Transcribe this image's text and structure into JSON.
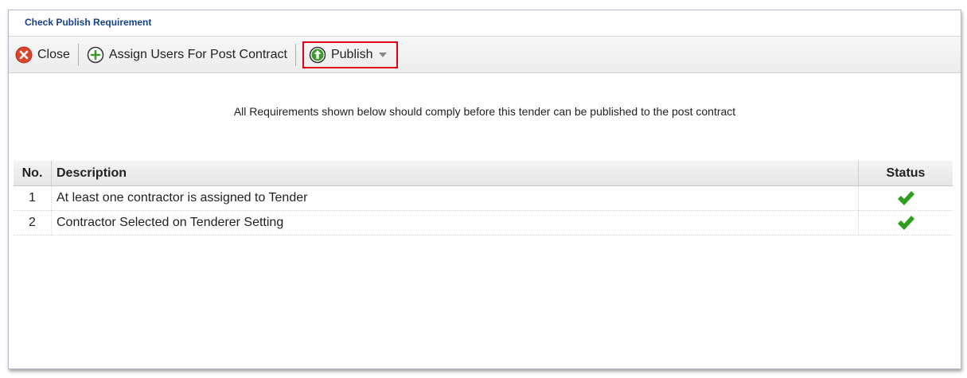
{
  "window": {
    "title": "Check Publish Requirement"
  },
  "toolbar": {
    "close": {
      "label": "Close",
      "icon": "close-icon"
    },
    "assign": {
      "label": "Assign Users For Post Contract",
      "icon": "plus-circle-icon"
    },
    "publish": {
      "label": "Publish",
      "icon": "up-arrow-circle-icon",
      "highlight_color": "#e0001b"
    }
  },
  "notice": "All Requirements shown below should comply before this tender can be published to the post contract",
  "grid": {
    "columns": {
      "no": "No.",
      "description": "Description",
      "status": "Status"
    },
    "rows": [
      {
        "no": "1",
        "description": "At least one contractor is assigned to Tender",
        "status": "check-icon"
      },
      {
        "no": "2",
        "description": "Contractor Selected on Tenderer Setting",
        "status": "check-icon"
      }
    ]
  },
  "colors": {
    "title": "#15428b",
    "check": "#2e9e1e",
    "close_icon": "#d9452c",
    "assign_icon": "#3a9b2c",
    "publish_icon": "#3a9b2c"
  }
}
